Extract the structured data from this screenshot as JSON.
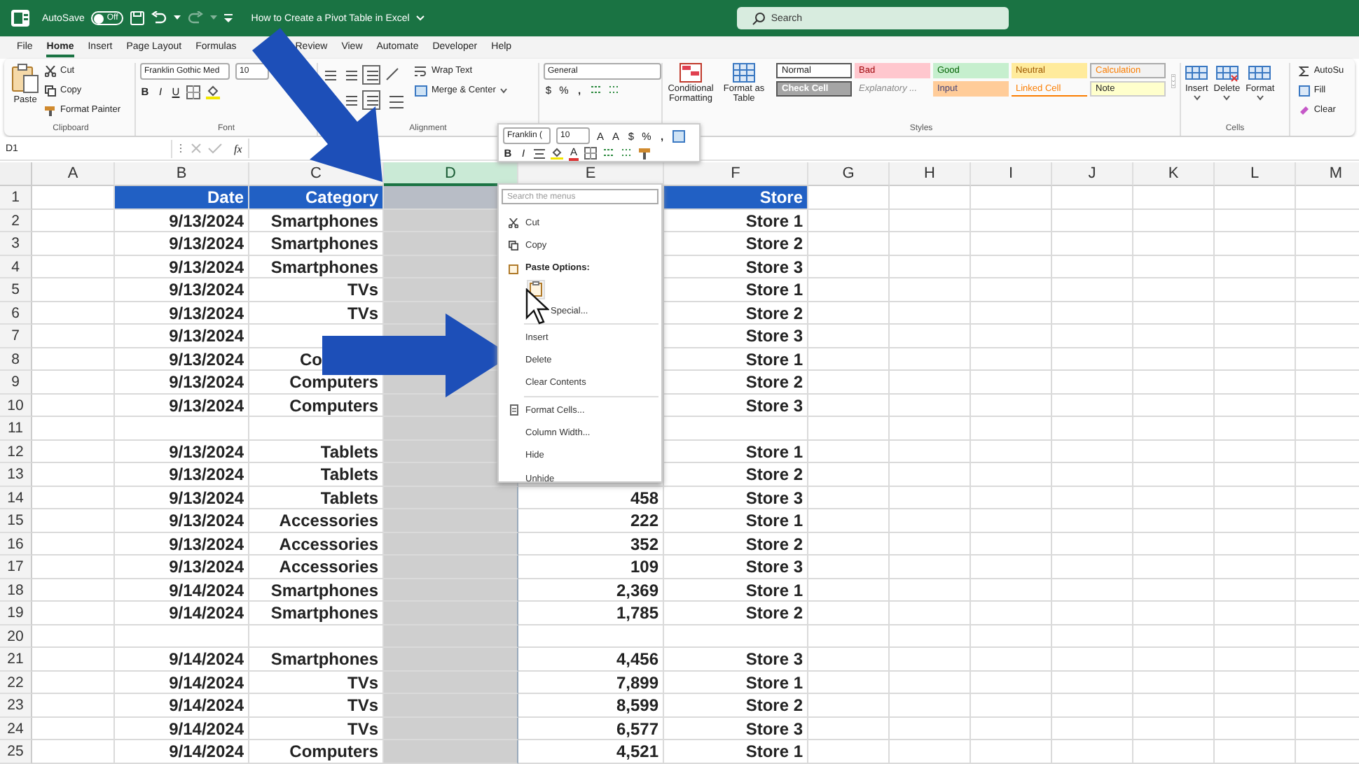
{
  "title_bar": {
    "autosave": {
      "label": "AutoSave",
      "state": "Off",
      "on": false
    },
    "document_title": "How to Create a Pivot Table in Excel",
    "search": {
      "placeholder": "Search"
    }
  },
  "tabs": [
    {
      "label": "File",
      "selected": false
    },
    {
      "label": "Home",
      "selected": true
    },
    {
      "label": "Insert",
      "selected": false
    },
    {
      "label": "Page Layout",
      "selected": false
    },
    {
      "label": "Formulas",
      "selected": false
    },
    {
      "label": "Review",
      "selected": false
    },
    {
      "label": "View",
      "selected": false
    },
    {
      "label": "Automate",
      "selected": false
    },
    {
      "label": "Developer",
      "selected": false
    },
    {
      "label": "Help",
      "selected": false
    }
  ],
  "ribbon": {
    "clipboard": {
      "paste": "Paste",
      "cut": "Cut",
      "copy": "Copy",
      "format_painter": "Format Painter",
      "label": "Clipboard"
    },
    "font": {
      "font_name": "Franklin Gothic Med",
      "font_size": "10",
      "bold": "B",
      "italic": "I",
      "underline": "U",
      "label": "Font"
    },
    "alignment": {
      "wrap_text": "Wrap Text",
      "merge_center": "Merge & Center",
      "label": "Alignment"
    },
    "number": {
      "format": "General",
      "currency": "$",
      "percent": "%",
      "comma": ","
    },
    "styles": {
      "conditional_formatting": "Conditional Formatting",
      "format_as_table": "Format as Table",
      "label": "Styles",
      "cell_styles": [
        {
          "label": "Normal",
          "kind": "normal"
        },
        {
          "label": "Bad",
          "kind": "bad"
        },
        {
          "label": "Good",
          "kind": "good"
        },
        {
          "label": "Neutral",
          "kind": "neutral"
        },
        {
          "label": "Calculation",
          "kind": "calculation"
        },
        {
          "label": "Check Cell",
          "kind": "check"
        },
        {
          "label": "Explanatory ...",
          "kind": "explanatory"
        },
        {
          "label": "Input",
          "kind": "input"
        },
        {
          "label": "Linked Cell",
          "kind": "linked"
        },
        {
          "label": "Note",
          "kind": "note"
        }
      ]
    },
    "cells": {
      "buttons": [
        "Insert",
        "Delete",
        "Format"
      ],
      "label": "Cells"
    },
    "editing": [
      "AutoSu",
      "Fill",
      "Clear"
    ]
  },
  "formula_bar": {
    "name_box": "D1",
    "function_label": "fx"
  },
  "mini_toolbar": {
    "font_name": "Franklin (",
    "font_size": "10",
    "grow_font": "A",
    "shrink_font": "A",
    "currency": "$",
    "percent": "%",
    "comma": ",",
    "bold": "B",
    "italic": "I",
    "font_color": "A"
  },
  "context_menu": {
    "search": {
      "placeholder": "Search the menus"
    },
    "sections": [
      [
        {
          "kind": "command",
          "label": "Cut"
        },
        {
          "kind": "command",
          "label": "Copy"
        },
        {
          "kind": "heading",
          "label": "Paste Options:"
        },
        {
          "kind": "paste-option"
        },
        {
          "kind": "command",
          "label": "Special..."
        }
      ],
      [
        {
          "kind": "command",
          "label": "Insert"
        },
        {
          "kind": "command",
          "label": "Delete"
        },
        {
          "kind": "command",
          "label": "Clear Contents"
        }
      ],
      [
        {
          "kind": "command",
          "label": "Format Cells..."
        },
        {
          "kind": "command",
          "label": "Column Width..."
        },
        {
          "kind": "command",
          "label": "Hide"
        },
        {
          "kind": "command",
          "label": "Unhide"
        }
      ]
    ]
  },
  "columns": [
    {
      "letter": "A",
      "selected": false
    },
    {
      "letter": "B",
      "selected": false
    },
    {
      "letter": "C",
      "selected": false
    },
    {
      "letter": "D",
      "selected": true
    },
    {
      "letter": "E",
      "selected": false
    },
    {
      "letter": "F",
      "selected": false
    },
    {
      "letter": "G",
      "selected": false
    },
    {
      "letter": "H",
      "selected": false
    },
    {
      "letter": "I",
      "selected": false
    },
    {
      "letter": "J",
      "selected": false
    },
    {
      "letter": "K",
      "selected": false
    },
    {
      "letter": "L",
      "selected": false
    },
    {
      "letter": "M",
      "selected": false
    }
  ],
  "rows": [
    {
      "row": "1",
      "kind": "header",
      "date": "Date",
      "category": "Category",
      "store": "Store"
    },
    {
      "row": "2",
      "kind": "data",
      "date": "9/13/2024",
      "category": "Smartphones",
      "store": "Store 1"
    },
    {
      "row": "3",
      "kind": "data",
      "date": "9/13/2024",
      "category": "Smartphones",
      "store": "Store 2"
    },
    {
      "row": "4",
      "kind": "data",
      "date": "9/13/2024",
      "category": "Smartphones",
      "store": "Store 3"
    },
    {
      "row": "5",
      "kind": "data",
      "date": "9/13/2024",
      "category": "TVs",
      "store": "Store 1"
    },
    {
      "row": "6",
      "kind": "data",
      "date": "9/13/2024",
      "category": "TVs",
      "store": "Store 2"
    },
    {
      "row": "7",
      "kind": "data",
      "date": "9/13/2024",
      "store": "Store 3"
    },
    {
      "row": "8",
      "kind": "data",
      "date": "9/13/2024",
      "category": "Co",
      "category_cut": true,
      "store": "Store 1"
    },
    {
      "row": "9",
      "kind": "data",
      "date": "9/13/2024",
      "category": "Computers",
      "store": "Store 2"
    },
    {
      "row": "10",
      "kind": "data",
      "date": "9/13/2024",
      "category": "Computers",
      "store": "Store 3"
    },
    {
      "row": "11",
      "kind": "data"
    },
    {
      "row": "12",
      "kind": "data",
      "date": "9/13/2024",
      "category": "Tablets",
      "store": "Store 1"
    },
    {
      "row": "13",
      "kind": "data",
      "date": "9/13/2024",
      "category": "Tablets",
      "store": "Store 2"
    },
    {
      "row": "14",
      "kind": "data",
      "date": "9/13/2024",
      "category": "Tablets",
      "value": "458",
      "store": "Store 3"
    },
    {
      "row": "15",
      "kind": "data",
      "date": "9/13/2024",
      "category": "Accessories",
      "value": "222",
      "store": "Store 1"
    },
    {
      "row": "16",
      "kind": "data",
      "date": "9/13/2024",
      "category": "Accessories",
      "value": "352",
      "store": "Store 2"
    },
    {
      "row": "17",
      "kind": "data",
      "date": "9/13/2024",
      "category": "Accessories",
      "value": "109",
      "store": "Store 3"
    },
    {
      "row": "18",
      "kind": "data",
      "date": "9/14/2024",
      "category": "Smartphones",
      "value": "2,369",
      "store": "Store 1"
    },
    {
      "row": "19",
      "kind": "data",
      "date": "9/14/2024",
      "category": "Smartphones",
      "value": "1,785",
      "store": "Store 2"
    },
    {
      "row": "20",
      "kind": "data"
    },
    {
      "row": "21",
      "kind": "data",
      "date": "9/14/2024",
      "category": "Smartphones",
      "value": "4,456",
      "store": "Store 3"
    },
    {
      "row": "22",
      "kind": "data",
      "date": "9/14/2024",
      "category": "TVs",
      "value": "7,899",
      "store": "Store 1"
    },
    {
      "row": "23",
      "kind": "data",
      "date": "9/14/2024",
      "category": "TVs",
      "value": "8,599",
      "store": "Store 2"
    },
    {
      "row": "24",
      "kind": "data",
      "date": "9/14/2024",
      "category": "TVs",
      "value": "6,577",
      "store": "Store 3"
    },
    {
      "row": "25",
      "kind": "data",
      "date": "9/14/2024",
      "category": "Computers",
      "value": "4,521",
      "store": "Store 1"
    }
  ]
}
